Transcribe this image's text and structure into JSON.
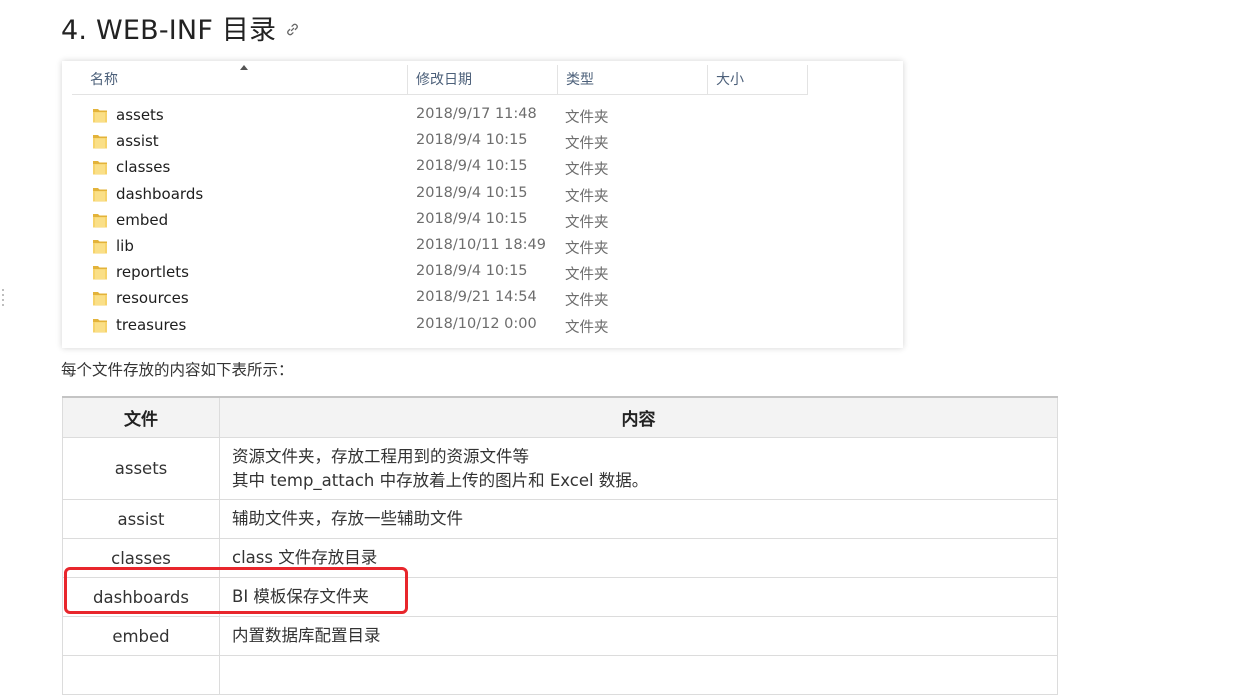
{
  "heading": {
    "title": "4. WEB-INF 目录"
  },
  "explorer": {
    "columns": {
      "name": "名称",
      "date": "修改日期",
      "type": "类型",
      "size": "大小"
    },
    "rows": [
      {
        "name": "assets",
        "date": "2018/9/17 11:48",
        "type": "文件夹"
      },
      {
        "name": "assist",
        "date": "2018/9/4 10:15",
        "type": "文件夹"
      },
      {
        "name": "classes",
        "date": "2018/9/4 10:15",
        "type": "文件夹"
      },
      {
        "name": "dashboards",
        "date": "2018/9/4 10:15",
        "type": "文件夹"
      },
      {
        "name": "embed",
        "date": "2018/9/4 10:15",
        "type": "文件夹"
      },
      {
        "name": "lib",
        "date": "2018/10/11 18:49",
        "type": "文件夹"
      },
      {
        "name": "reportlets",
        "date": "2018/9/4 10:15",
        "type": "文件夹"
      },
      {
        "name": "resources",
        "date": "2018/9/21 14:54",
        "type": "文件夹"
      },
      {
        "name": "treasures",
        "date": "2018/10/12 0:00",
        "type": "文件夹"
      }
    ]
  },
  "intro": "每个文件存放的内容如下表所示：",
  "table": {
    "headers": {
      "file": "文件",
      "content": "内容"
    },
    "rows": [
      {
        "file": "assets",
        "line1": "资源文件夹，存放工程用到的资源文件等",
        "line2": "其中 temp_attach 中存放着上传的图片和 Excel 数据。"
      },
      {
        "file": "assist",
        "line1": "辅助文件夹，存放一些辅助文件"
      },
      {
        "file": "classes",
        "line1": "class 文件存放目录"
      },
      {
        "file": "dashboards",
        "line1": "BI 模板保存文件夹"
      },
      {
        "file": "embed",
        "line1": "内置数据库配置目录"
      }
    ]
  },
  "colors": {
    "highlight": "#e8262c",
    "folder": "#f2c94c"
  }
}
